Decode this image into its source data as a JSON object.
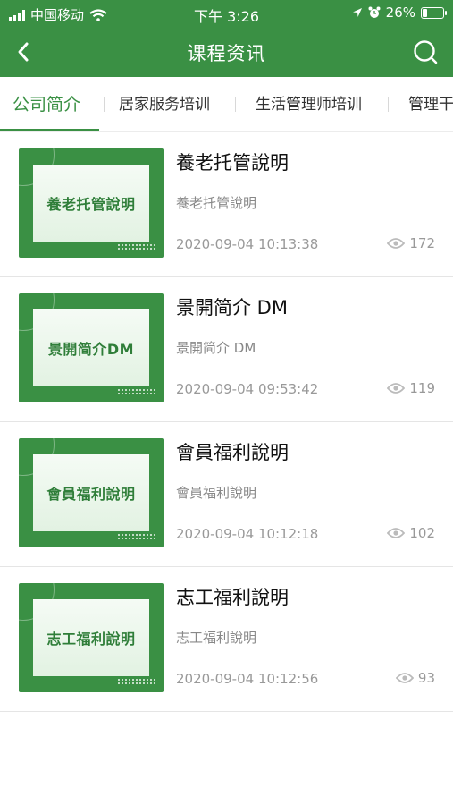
{
  "status_bar": {
    "carrier": "中国移动",
    "time": "下午 3:26",
    "battery_text": "26%",
    "battery_level": 0.26,
    "icons": [
      "signal-icon",
      "wifi-icon",
      "location-icon",
      "alarm-icon",
      "battery-icon"
    ]
  },
  "nav": {
    "title": "课程资讯",
    "back_icon": "chevron-left-icon",
    "search_icon": "search-icon"
  },
  "tabs": [
    {
      "label": "公司简介",
      "active": true
    },
    {
      "label": "居家服务培训",
      "active": false
    },
    {
      "label": "生活管理师培训",
      "active": false
    },
    {
      "label": "管理干",
      "active": false
    }
  ],
  "colors": {
    "brand_green": "#3a9044",
    "thumb_text_green": "#2f7e39"
  },
  "items": [
    {
      "thumb_text": "養老托管說明",
      "title": "養老托管說明",
      "subtitle": "養老托管說明",
      "date": "2020-09-04 10:13:38",
      "views": "172"
    },
    {
      "thumb_text": "景開简介DM",
      "title": "景開简介 DM",
      "subtitle": "景開简介 DM",
      "date": "2020-09-04 09:53:42",
      "views": "119"
    },
    {
      "thumb_text": "會員福利說明",
      "title": "會員福利說明",
      "subtitle": "會員福利說明",
      "date": "2020-09-04 10:12:18",
      "views": "102"
    },
    {
      "thumb_text": "志工福利說明",
      "title": "志工福利說明",
      "subtitle": "志工福利說明",
      "date": "2020-09-04 10:12:56",
      "views": "93"
    }
  ]
}
